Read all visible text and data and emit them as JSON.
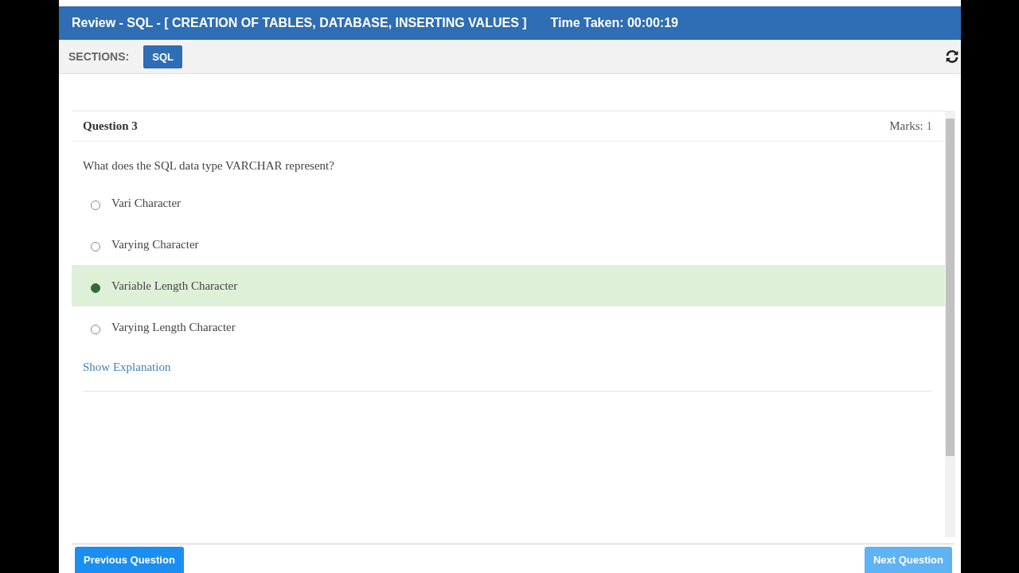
{
  "header": {
    "title": "Review - SQL - [ CREATION OF TABLES, DATABASE, INSERTING VALUES ]",
    "time_taken": "Time Taken: 00:00:19"
  },
  "sections": {
    "label": "SECTIONS:",
    "tabs": [
      {
        "label": "SQL",
        "selected": true
      }
    ]
  },
  "question": {
    "number": "Question 3",
    "marks_label": "Marks:",
    "marks_value": "1",
    "text": "What does the SQL data type VARCHAR represent?",
    "options": [
      {
        "label": "Vari Character",
        "selected": false
      },
      {
        "label": "Varying Character",
        "selected": false
      },
      {
        "label": "Variable Length Character",
        "selected": true
      },
      {
        "label": "Varying Length Character",
        "selected": false
      }
    ],
    "explanation_link": "Show Explanation"
  },
  "footer": {
    "buttons": [
      {
        "label": "Previous Question",
        "hovered": false
      },
      {
        "label": "Next Question",
        "hovered": true
      }
    ]
  }
}
